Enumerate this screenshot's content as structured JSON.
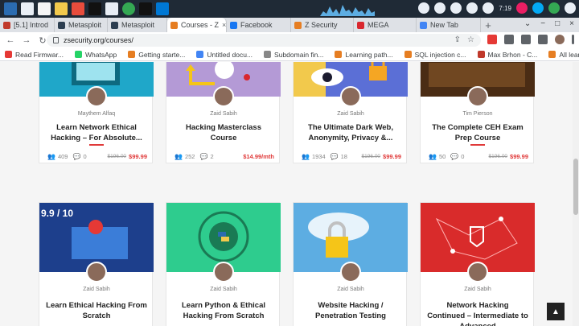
{
  "taskbar": {
    "time": "7:19"
  },
  "tabs": [
    {
      "label": "[5.1] Introd",
      "color": "#c0392b"
    },
    {
      "label": "Metasploit",
      "color": "#2c3e50"
    },
    {
      "label": "Metasploit",
      "color": "#2c3e50"
    },
    {
      "label": "Courses - Z",
      "color": "#e67e22",
      "active": true
    },
    {
      "label": "Facebook",
      "color": "#1877f2"
    },
    {
      "label": "Z Security",
      "color": "#e67e22"
    },
    {
      "label": "MEGA",
      "color": "#d9272e"
    },
    {
      "label": "New Tab",
      "color": "#4285f4"
    }
  ],
  "address": {
    "url": "zsecurity.org/courses/"
  },
  "bookmarks": [
    {
      "label": "Read Firmwar...",
      "color": "#e53935"
    },
    {
      "label": "WhatsApp",
      "color": "#25d366"
    },
    {
      "label": "Getting starte...",
      "color": "#e67e22"
    },
    {
      "label": "Untitled docu...",
      "color": "#4285f4"
    },
    {
      "label": "Subdomain fin...",
      "color": "#888888"
    },
    {
      "label": "Learning path...",
      "color": "#e67e22"
    },
    {
      "label": "SQL injection c...",
      "color": "#e67e22"
    },
    {
      "label": "Max Brhon - C...",
      "color": "#c0392b"
    },
    {
      "label": "All learning m...",
      "color": "#e67e22"
    }
  ],
  "courses": [
    {
      "instructor": "Maythem Alfaq",
      "title": "Learn Network Ethical Hacking – For Absolute...",
      "students": "409",
      "comments": "0",
      "old_price": "$196.00",
      "price": "$99.99"
    },
    {
      "instructor": "Zaid Sabih",
      "title": "Hacking Masterclass Course",
      "students": "252",
      "comments": "2",
      "old_price": "",
      "price": "$14.99/mth"
    },
    {
      "instructor": "Zaid Sabih",
      "title": "The Ultimate Dark Web, Anonymity, Privacy &...",
      "students": "1934",
      "comments": "18",
      "old_price": "$196.00",
      "price": "$99.99"
    },
    {
      "instructor": "Tim Pierson",
      "title": "The Complete CEH Exam Prep Course",
      "students": "50",
      "comments": "0",
      "old_price": "$196.00",
      "price": "$99.99"
    },
    {
      "instructor": "Zaid Sabih",
      "title": "Learn Ethical Hacking From Scratch",
      "students": "",
      "comments": "",
      "old_price": "",
      "price": ""
    },
    {
      "instructor": "Zaid Sabih",
      "title": "Learn Python & Ethical Hacking From Scratch",
      "students": "",
      "comments": "",
      "old_price": "",
      "price": ""
    },
    {
      "instructor": "Zaid Sabih",
      "title": "Website Hacking / Penetration Testing",
      "students": "",
      "comments": "",
      "old_price": "",
      "price": ""
    },
    {
      "instructor": "Zaid Sabih",
      "title": "Network Hacking Continued – Intermediate to Advanced",
      "students": "",
      "comments": "",
      "old_price": "",
      "price": ""
    }
  ],
  "thumb_text": {
    "course5": "9.9 / 10"
  },
  "colors": {
    "accent": "#e03a3a",
    "python_bg": "#2ecc8e",
    "network_bg": "#e53935",
    "cloud_bg": "#5dade2",
    "dark_bg": "#1b1b2f"
  }
}
